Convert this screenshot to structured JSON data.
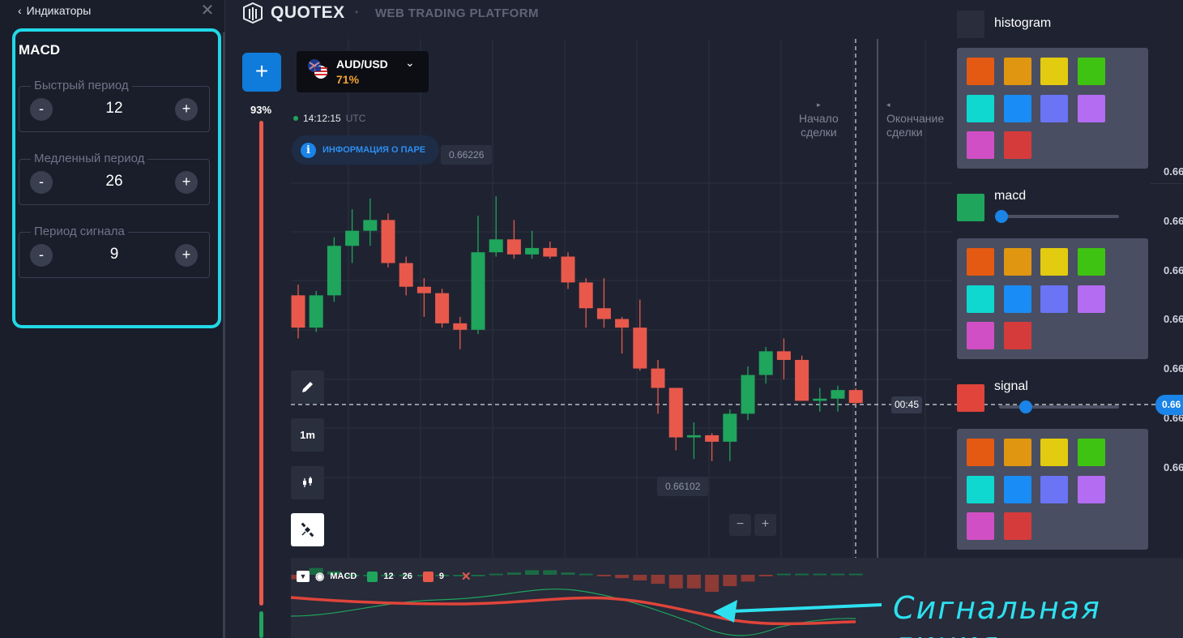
{
  "left_panel": {
    "back_label": "Индикаторы",
    "indicator_title": "MACD",
    "fields": [
      {
        "label": "Быстрый период",
        "value": "12",
        "minus": "-",
        "plus": "+"
      },
      {
        "label": "Медленный период",
        "value": "26",
        "minus": "-",
        "plus": "+"
      },
      {
        "label": "Период сигнала",
        "value": "9",
        "minus": "-",
        "plus": "+"
      }
    ]
  },
  "header": {
    "brand": "QUOTEX",
    "separator": "•",
    "subtitle": "WEB TRADING PLATFORM"
  },
  "toolbar": {
    "add_label": "+",
    "asset_name": "AUD/USD",
    "asset_payout": "71%",
    "timeframe": "1m"
  },
  "sidebar_percent": "93%",
  "chart": {
    "time": "14:12:15",
    "timezone": "UTC",
    "info_label": "ИНФОРМАЦИЯ О ПАРЕ",
    "high_price": "0.66226",
    "low_price": "0.66102",
    "deal_start": [
      "Начало",
      "сделки"
    ],
    "deal_end": [
      "Окончание",
      "сделки"
    ],
    "timer": "00:45",
    "zoom_out": "−",
    "zoom_in": "+",
    "axis_prices": [
      "0.66",
      "0.66",
      "0.66",
      "0.66",
      "0.66",
      "0.66",
      "0.66"
    ],
    "axis_price_partial": [
      "0.66",
      "0.66",
      "0.66",
      "0.66",
      "0.66",
      "0.66",
      "0.66"
    ],
    "current_price": "0.66"
  },
  "macd_panel": {
    "name": "MACD",
    "fast": "12",
    "slow": "26",
    "signal": "9",
    "green": "#1fa55c",
    "red": "#e8594c"
  },
  "annotation": "Сигнальная линия",
  "colors_panel": {
    "histogram_label": "histogram",
    "macd_label": "macd",
    "signal_label": "signal",
    "histogram_color": "#2a2e3c",
    "macd_color": "#1fa55c",
    "signal_color": "#e0443a",
    "palette": [
      "#e55a12",
      "#e09610",
      "#e3cb0f",
      "#3fc312",
      "#0fd8d0",
      "#1a8cf5",
      "#6a74f5",
      "#b36cf2",
      "#d14fc4",
      "#d63b3b"
    ],
    "macd_slider": 0.02,
    "signal_slider": 0.22
  },
  "candles": [
    {
      "o": 0.66155,
      "c": 0.6614,
      "h": 0.6616,
      "l": 0.66135
    },
    {
      "o": 0.6614,
      "c": 0.66155,
      "h": 0.66157,
      "l": 0.66138
    },
    {
      "o": 0.66155,
      "c": 0.66178,
      "h": 0.66182,
      "l": 0.66152
    },
    {
      "o": 0.66178,
      "c": 0.66185,
      "h": 0.66195,
      "l": 0.6617
    },
    {
      "o": 0.66185,
      "c": 0.6619,
      "h": 0.662,
      "l": 0.66178
    },
    {
      "o": 0.6619,
      "c": 0.6617,
      "h": 0.66193,
      "l": 0.66168
    },
    {
      "o": 0.6617,
      "c": 0.66159,
      "h": 0.66173,
      "l": 0.66155
    },
    {
      "o": 0.66159,
      "c": 0.66156,
      "h": 0.66163,
      "l": 0.66145
    },
    {
      "o": 0.66156,
      "c": 0.66142,
      "h": 0.66158,
      "l": 0.6614
    },
    {
      "o": 0.66142,
      "c": 0.66139,
      "h": 0.66145,
      "l": 0.6613
    },
    {
      "o": 0.66139,
      "c": 0.66175,
      "h": 0.66192,
      "l": 0.66137
    },
    {
      "o": 0.66175,
      "c": 0.66181,
      "h": 0.66201,
      "l": 0.66173
    },
    {
      "o": 0.66181,
      "c": 0.66174,
      "h": 0.6619,
      "l": 0.66172
    },
    {
      "o": 0.66174,
      "c": 0.66177,
      "h": 0.66185,
      "l": 0.66172
    },
    {
      "o": 0.66177,
      "c": 0.66173,
      "h": 0.6618,
      "l": 0.66172
    },
    {
      "o": 0.66173,
      "c": 0.66161,
      "h": 0.66175,
      "l": 0.66158
    },
    {
      "o": 0.66161,
      "c": 0.66149,
      "h": 0.66163,
      "l": 0.6614
    },
    {
      "o": 0.66149,
      "c": 0.66144,
      "h": 0.66163,
      "l": 0.6614
    },
    {
      "o": 0.66144,
      "c": 0.6614,
      "h": 0.66145,
      "l": 0.66128
    },
    {
      "o": 0.6614,
      "c": 0.66121,
      "h": 0.66153,
      "l": 0.6612
    },
    {
      "o": 0.66121,
      "c": 0.66112,
      "h": 0.66125,
      "l": 0.661
    },
    {
      "o": 0.66112,
      "c": 0.66089,
      "h": 0.66112,
      "l": 0.66083
    },
    {
      "o": 0.66089,
      "c": 0.6609,
      "h": 0.66096,
      "l": 0.66079
    },
    {
      "o": 0.6609,
      "c": 0.66087,
      "h": 0.66091,
      "l": 0.66078
    },
    {
      "o": 0.66087,
      "c": 0.661,
      "h": 0.66102,
      "l": 0.66078
    },
    {
      "o": 0.661,
      "c": 0.66118,
      "h": 0.66122,
      "l": 0.66097
    },
    {
      "o": 0.66118,
      "c": 0.66129,
      "h": 0.66131,
      "l": 0.66114
    },
    {
      "o": 0.66129,
      "c": 0.66125,
      "h": 0.66135,
      "l": 0.66116
    },
    {
      "o": 0.66125,
      "c": 0.66106,
      "h": 0.66127,
      "l": 0.66106
    },
    {
      "o": 0.66106,
      "c": 0.66107,
      "h": 0.66112,
      "l": 0.66101
    },
    {
      "o": 0.66107,
      "c": 0.66111,
      "h": 0.66113,
      "l": 0.66101
    },
    {
      "o": 0.66111,
      "c": 0.66105,
      "h": 0.66112,
      "l": 0.66104
    }
  ],
  "macd_hist": [
    -0.4,
    0.6,
    0.3,
    0.0,
    0.0,
    0.0,
    0.0,
    0.0,
    0.0,
    0.0,
    0.0,
    0.1,
    0.2,
    0.4,
    0.4,
    0.2,
    0.1,
    -0.1,
    -0.3,
    -0.5,
    -0.8,
    -1.2,
    -1.2,
    -1.5,
    -1.0,
    -0.6,
    -0.1,
    0.1,
    0.1,
    0.1,
    0.1,
    0.1
  ]
}
